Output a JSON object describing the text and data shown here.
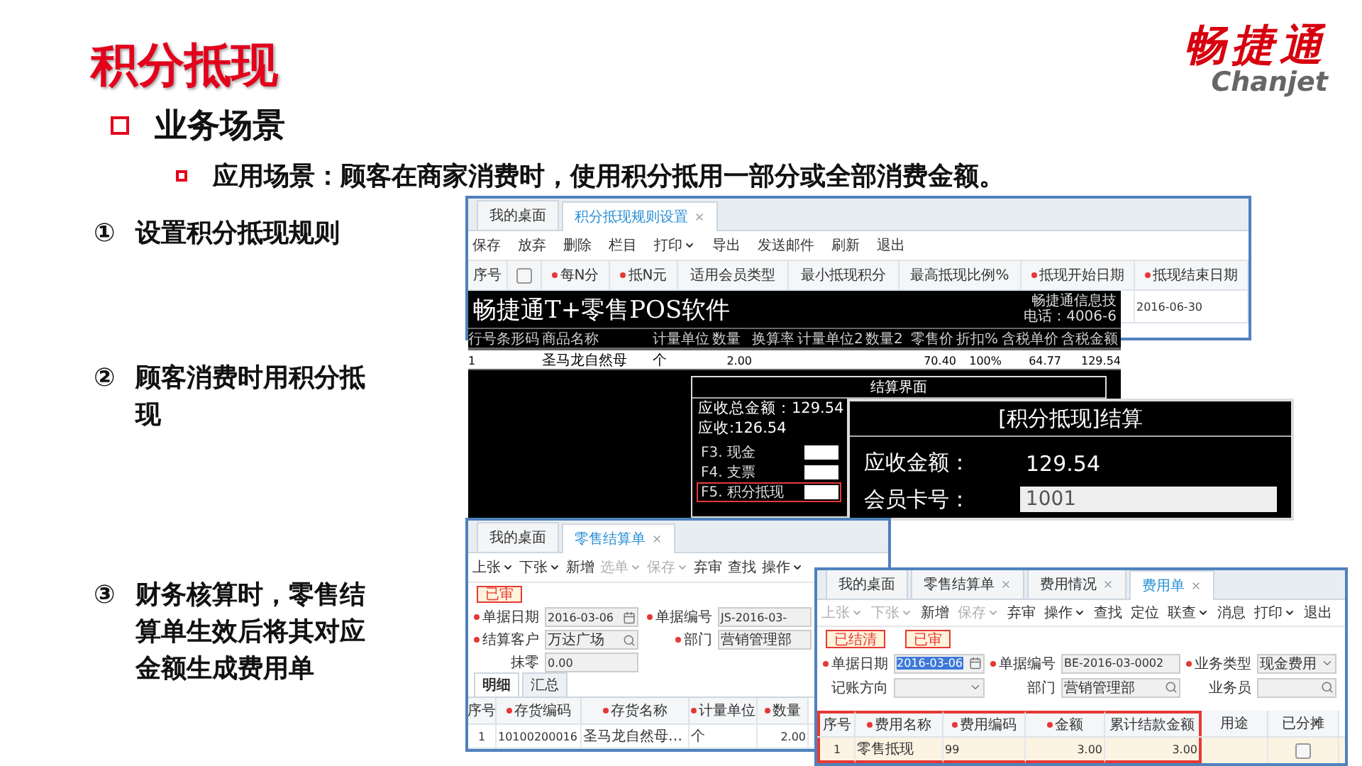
{
  "title": "积分抵现",
  "logo": {
    "mark": "畅捷通",
    "wordmark": "Chanjet"
  },
  "heading": "业务场景",
  "scenario": "应用场景：顾客在商家消费时，使用积分抵用一部分或全部消费金额。",
  "steps": [
    {
      "marker": "①",
      "text": "设置积分抵现规则"
    },
    {
      "marker": "②",
      "text": "顾客消费时用积分抵现"
    },
    {
      "marker": "③",
      "text": "财务核算时，零售结算单生效后将其对应金额生成费用单"
    }
  ],
  "rule_window": {
    "tabs": [
      {
        "label": "我的桌面",
        "selected": false,
        "closable": false
      },
      {
        "label": "积分抵现规则设置",
        "selected": true,
        "closable": true
      }
    ],
    "toolbar": [
      {
        "label": "保存",
        "dropdown": false,
        "disabled": false
      },
      {
        "label": "放弃",
        "dropdown": false,
        "disabled": false
      },
      {
        "label": "删除",
        "dropdown": false,
        "disabled": false
      },
      {
        "label": "栏目",
        "dropdown": false,
        "disabled": false
      },
      {
        "label": "打印",
        "dropdown": true,
        "disabled": false
      },
      {
        "label": "导出",
        "dropdown": false,
        "disabled": false
      },
      {
        "label": "发送邮件",
        "dropdown": false,
        "disabled": false
      },
      {
        "label": "刷新",
        "dropdown": false,
        "disabled": false
      },
      {
        "label": "退出",
        "dropdown": false,
        "disabled": false
      }
    ],
    "columns": [
      {
        "kind": "text",
        "label": "序号",
        "required": false
      },
      {
        "kind": "checkbox",
        "checked": false
      },
      {
        "kind": "text",
        "label": "每N分",
        "required": true
      },
      {
        "kind": "text",
        "label": "抵N元",
        "required": true
      },
      {
        "kind": "text",
        "label": "适用会员类型",
        "required": false
      },
      {
        "kind": "text",
        "label": "最小抵现积分",
        "required": false
      },
      {
        "kind": "text",
        "label": "最高抵现比例%",
        "required": false
      },
      {
        "kind": "text",
        "label": "抵现开始日期",
        "required": true
      },
      {
        "kind": "text",
        "label": "抵现结束日期",
        "required": true
      }
    ],
    "rows": [
      {
        "end_date": "2016-06-30"
      }
    ]
  },
  "pos": {
    "title": "畅捷通T+零售POS软件",
    "company": "畅捷通信息技",
    "phone": "电话：4006-6",
    "columns": [
      "行号",
      "条形码",
      "商品名称",
      "计量单位",
      "数量",
      "换算率",
      "计量单位2",
      "数量2",
      "零售价",
      "折扣%",
      "含税单价",
      "含税金额"
    ],
    "rows": [
      {
        "cells": [
          "1",
          null,
          "圣马龙自然母",
          "个",
          "2.00",
          null,
          null,
          null,
          "70.40",
          "100%",
          "64.77",
          "129.54"
        ]
      }
    ]
  },
  "settle_dialog": {
    "title": "结算界面",
    "total": "应收总金额：129.54",
    "due": "应收:126.54",
    "methods": [
      {
        "label": "F3. 现金",
        "selected": false
      },
      {
        "label": "F4. 支票",
        "selected": false
      },
      {
        "label": "F5. 积分抵现",
        "selected": true
      }
    ]
  },
  "points_dialog": {
    "title": "[积分抵现]结算",
    "fields": [
      {
        "kind": "text",
        "label": "应收金额：",
        "value": "129.54"
      },
      {
        "kind": "input",
        "label": "会员卡号：",
        "value": "1001"
      }
    ]
  },
  "settlement_window": {
    "tabs": [
      {
        "label": "我的桌面",
        "selected": false,
        "closable": false
      },
      {
        "label": "零售结算单",
        "selected": true,
        "closable": true
      }
    ],
    "toolbar": [
      {
        "label": "上张",
        "dropdown": true,
        "disabled": false
      },
      {
        "label": "下张",
        "dropdown": true,
        "disabled": false
      },
      {
        "label": "新增",
        "dropdown": false,
        "disabled": false
      },
      {
        "label": "选单",
        "dropdown": true,
        "disabled": true
      },
      {
        "label": "保存",
        "dropdown": true,
        "disabled": true
      },
      {
        "label": "弃审",
        "dropdown": false,
        "disabled": false
      },
      {
        "label": "查找",
        "dropdown": false,
        "disabled": false
      },
      {
        "label": "操作",
        "dropdown": true,
        "disabled": false
      }
    ],
    "badges": [
      "已审"
    ],
    "fields": [
      {
        "label": "单据日期",
        "required": true,
        "kind": "date",
        "value": "2016-03-06",
        "highlighted": false
      },
      {
        "label": "单据编号",
        "required": true,
        "kind": "text",
        "value": "JS-2016-03-",
        "highlighted": false
      },
      {
        "label": "结算客户",
        "required": true,
        "kind": "lookup",
        "value": "万达广场",
        "highlighted": false
      },
      {
        "label": "部门",
        "required": true,
        "kind": "text",
        "value": "营销管理部",
        "highlighted": false
      },
      {
        "label": "抹零",
        "required": false,
        "kind": "text",
        "value": "0.00",
        "highlighted": false
      }
    ],
    "subtabs": [
      {
        "label": "明细",
        "selected": true
      },
      {
        "label": "汇总",
        "selected": false
      }
    ],
    "columns": [
      {
        "label": "序号",
        "required": false
      },
      {
        "label": "存货编码",
        "required": true
      },
      {
        "label": "存货名称",
        "required": true
      },
      {
        "label": "计量单位",
        "required": true
      },
      {
        "label": "数量",
        "required": true
      }
    ],
    "rows": [
      {
        "cells": [
          "1",
          "10100200016",
          "圣马龙自然母…",
          "个",
          "2.00"
        ]
      }
    ]
  },
  "expense_window": {
    "tabs": [
      {
        "label": "我的桌面",
        "selected": false,
        "closable": false
      },
      {
        "label": "零售结算单",
        "selected": false,
        "closable": true
      },
      {
        "label": "费用情况",
        "selected": false,
        "closable": true
      },
      {
        "label": "费用单",
        "selected": true,
        "closable": true
      }
    ],
    "toolbar": [
      {
        "label": "上张",
        "dropdown": true,
        "disabled": true
      },
      {
        "label": "下张",
        "dropdown": true,
        "disabled": true
      },
      {
        "label": "新增",
        "dropdown": false,
        "disabled": false
      },
      {
        "label": "保存",
        "dropdown": true,
        "disabled": true
      },
      {
        "label": "弃审",
        "dropdown": false,
        "disabled": false
      },
      {
        "label": "操作",
        "dropdown": true,
        "disabled": false
      },
      {
        "label": "查找",
        "dropdown": false,
        "disabled": false
      },
      {
        "label": "定位",
        "dropdown": false,
        "disabled": false
      },
      {
        "label": "联查",
        "dropdown": true,
        "disabled": false
      },
      {
        "label": "消息",
        "dropdown": false,
        "disabled": false
      },
      {
        "label": "打印",
        "dropdown": true,
        "disabled": false
      },
      {
        "label": "退出",
        "dropdown": false,
        "disabled": false
      }
    ],
    "badges": [
      "已结清",
      "已审"
    ],
    "fields": [
      {
        "label": "单据日期",
        "required": true,
        "kind": "date",
        "value": "2016-03-06",
        "highlighted": true
      },
      {
        "label": "单据编号",
        "required": true,
        "kind": "text",
        "value": "BE-2016-03-0002",
        "highlighted": false
      },
      {
        "label": "业务类型",
        "required": true,
        "kind": "select",
        "value": "现金费用",
        "highlighted": false
      },
      {
        "label": "记账方向",
        "required": false,
        "kind": "select"
      },
      {
        "label": "部门",
        "required": false,
        "kind": "lookup",
        "value": "营销管理部",
        "highlighted": false
      },
      {
        "label": "业务员",
        "required": false,
        "kind": "lookup"
      }
    ],
    "columns": [
      {
        "label": "序号",
        "required": false,
        "highlighted": true
      },
      {
        "label": "费用名称",
        "required": true,
        "highlighted": true
      },
      {
        "label": "费用编码",
        "required": true,
        "highlighted": true
      },
      {
        "label": "金额",
        "required": true,
        "highlighted": true
      },
      {
        "label": "累计结款金额",
        "required": false,
        "highlighted": true
      },
      {
        "label": "用途",
        "required": false,
        "highlighted": false
      },
      {
        "label": "已分摊",
        "required": false,
        "highlighted": false
      }
    ],
    "rows": [
      {
        "cells": [
          "1",
          "零售抵现",
          "99",
          "3.00",
          "3.00",
          null
        ],
        "allocated": false
      }
    ]
  }
}
